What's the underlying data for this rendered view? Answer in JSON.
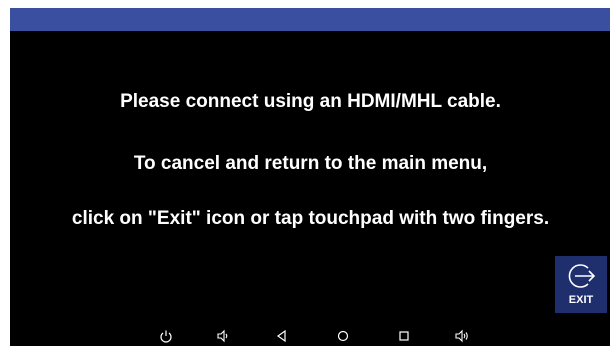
{
  "message": {
    "line1": "Please connect using an HDMI/MHL cable.",
    "line2": "To cancel and return to the main menu,",
    "line3": "click on \"Exit\" icon or tap touchpad with two fingers."
  },
  "exit_button": {
    "label": "EXIT",
    "icon": "exit-arrow-icon"
  },
  "navbar": {
    "icons": [
      "power-icon",
      "volume-down-icon",
      "back-icon",
      "home-icon",
      "recents-icon",
      "volume-up-icon"
    ]
  },
  "colors": {
    "status_bar": "#3a4fa0",
    "screen_bg": "#000000",
    "exit_button_bg": "#1f2f6e",
    "text": "#ffffff"
  }
}
